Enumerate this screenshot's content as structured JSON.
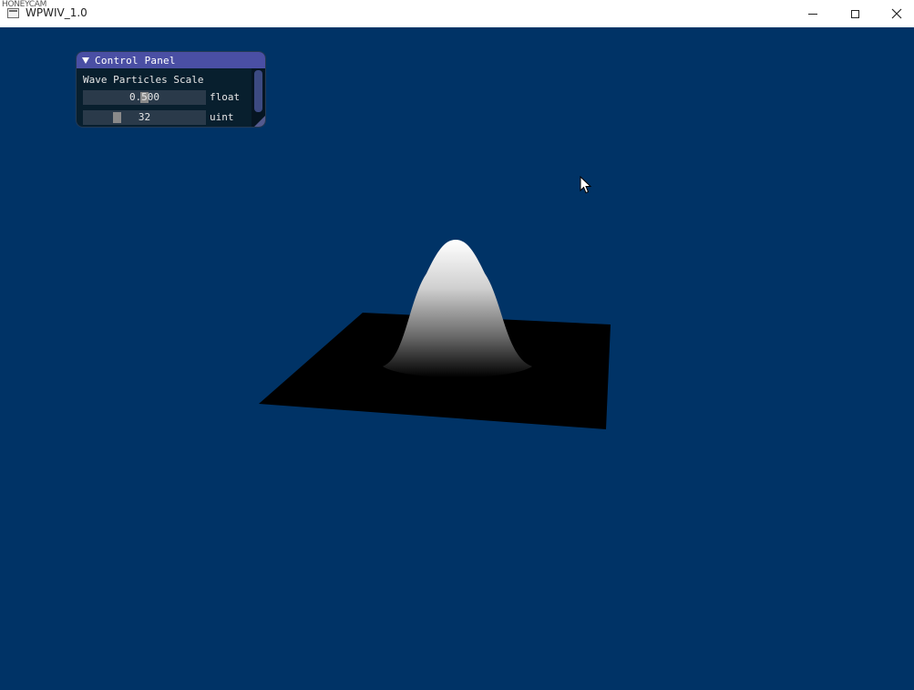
{
  "window": {
    "title": "WPWIV_1.0",
    "watermark": "HONEYCAM",
    "app_icon": "window-icon",
    "controls": [
      "minimize-icon",
      "maximize-icon",
      "close-icon"
    ],
    "close_glyph": "✕"
  },
  "scene": {
    "background_color": "#003366",
    "plane_color": "#000000",
    "surface_peak_color": "#ffffff"
  },
  "control_panel": {
    "title": "Control Panel",
    "header_color": "#4a4fa4",
    "label": "Wave Particles Scale",
    "float_slider": {
      "value": "0.500",
      "type_label": "float"
    },
    "uint_slider": {
      "value": "32",
      "type_label": "uint"
    }
  },
  "cursor": "mouse-pointer-icon"
}
